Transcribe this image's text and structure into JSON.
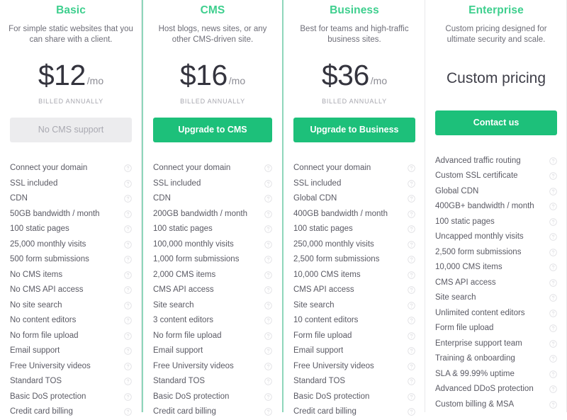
{
  "meta": {
    "billed_note": "BILLED ANNUALLY",
    "accent_green": "#3ecf8e",
    "button_green": "#1dc07a",
    "highlight_border": "#8fd6bb",
    "disabled_bg": "#ececee",
    "help_icon": "question-circle-icon"
  },
  "plans": [
    {
      "name": "Basic",
      "description": "For simple static websites that you can share with a client.",
      "price_amount": "$12",
      "price_period": "/mo",
      "price_custom": null,
      "billed_note": "BILLED ANNUALLY",
      "cta_label": "No CMS support",
      "cta_state": "disabled",
      "highlighted": false,
      "features": [
        "Connect your domain",
        "SSL included",
        "CDN",
        "50GB bandwidth / month",
        "100 static pages",
        "25,000 monthly visits",
        "500 form submissions",
        "No CMS items",
        "No CMS API access",
        "No site search",
        "No content editors",
        "No form file upload",
        "Email support",
        "Free University videos",
        "Standard TOS",
        "Basic DoS protection",
        "Credit card billing"
      ]
    },
    {
      "name": "CMS",
      "description": "Host blogs, news sites, or any other CMS-driven site.",
      "price_amount": "$16",
      "price_period": "/mo",
      "price_custom": null,
      "billed_note": "BILLED ANNUALLY",
      "cta_label": "Upgrade to CMS",
      "cta_state": "primary",
      "highlighted": true,
      "features": [
        "Connect your domain",
        "SSL included",
        "CDN",
        "200GB bandwidth / month",
        "100 static pages",
        "100,000 monthly visits",
        "1,000 form submissions",
        "2,000 CMS items",
        "CMS API access",
        "Site search",
        "3 content editors",
        "No form file upload",
        "Email support",
        "Free University videos",
        "Standard TOS",
        "Basic DoS protection",
        "Credit card billing"
      ]
    },
    {
      "name": "Business",
      "description": "Best for teams and high-traffic business sites.",
      "price_amount": "$36",
      "price_period": "/mo",
      "price_custom": null,
      "billed_note": "BILLED ANNUALLY",
      "cta_label": "Upgrade to Business",
      "cta_state": "primary",
      "highlighted": false,
      "features": [
        "Connect your domain",
        "SSL included",
        "Global CDN",
        "400GB bandwidth / month",
        "100 static pages",
        "250,000 monthly visits",
        "2,500 form submissions",
        "10,000 CMS items",
        "CMS API access",
        "Site search",
        "10 content editors",
        "Form file upload",
        "Email support",
        "Free University videos",
        "Standard TOS",
        "Basic DoS protection",
        "Credit card billing"
      ]
    },
    {
      "name": "Enterprise",
      "description": "Custom pricing designed for ultimate security and scale.",
      "price_amount": null,
      "price_period": null,
      "price_custom": "Custom pricing",
      "billed_note": "",
      "cta_label": "Contact us",
      "cta_state": "primary",
      "highlighted": false,
      "features": [
        "Advanced traffic routing",
        "Custom SSL certificate",
        "Global CDN",
        "400GB+ bandwidth / month",
        "100 static pages",
        "Uncapped monthly visits",
        "2,500 form submissions",
        "10,000 CMS items",
        "CMS API access",
        "Site search",
        "Unlimited content editors",
        "Form file upload",
        "Enterprise support team",
        "Training & onboarding",
        "SLA & 99.99% uptime",
        "Advanced DDoS protection",
        "Custom billing & MSA"
      ]
    }
  ]
}
